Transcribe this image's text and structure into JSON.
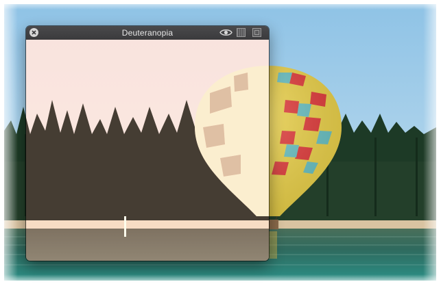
{
  "window": {
    "title": "Deuteranopia"
  },
  "icons": {
    "close": "close-icon",
    "preview": "eye-icon",
    "panel_split": "split-view-icon",
    "panel_full": "full-view-icon"
  },
  "colors": {
    "titlebar": "#3d3d3f",
    "sky": "#a8cfe8",
    "sky_simulated": "#d9c6e6",
    "water": "#3b7a70"
  }
}
